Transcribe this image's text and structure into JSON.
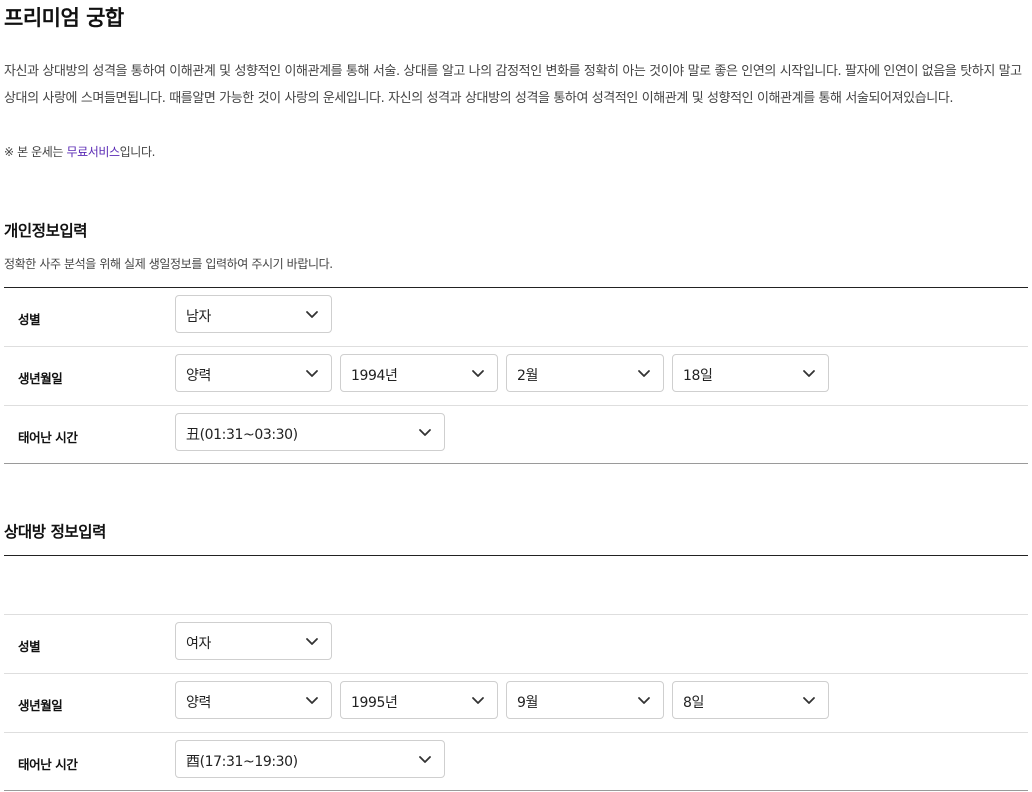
{
  "title": "프리미엄 궁합",
  "description": "자신과 상대방의 성격을 통하여 이해관계 및 성향적인 이해관계를 통해 서술. 상대를 알고 나의 감정적인 변화를 정확히 아는 것이야 말로 좋은 인연의 시작입니다. 팔자에 인연이 없음을 탓하지 말고 상대의 사랑에 스며들면됩니다. 때를알면 가능한 것이 사랑의 운세입니다. 자신의 성격과 상대방의 성격을 통하여 성격적인 이해관계 및 성향적인 이해관계를 통해 서술되어져있습니다.",
  "note": {
    "prefix": "※ 본 운세는 ",
    "link": "무료서비스",
    "suffix": "입니다."
  },
  "personal": {
    "title": "개인정보입력",
    "subtitle": "정확한 사주 분석을 위해 실제 생일정보를 입력하여 주시기 바랍니다.",
    "gender_label": "성별",
    "gender": "남자",
    "birth_label": "생년월일",
    "calendar": "양력",
    "year": "1994년",
    "month": "2월",
    "day": "18일",
    "time_label": "태어난 시간",
    "time": "丑(01:31~03:30)"
  },
  "partner": {
    "title": "상대방 정보입력",
    "gender_label": "성별",
    "gender": "여자",
    "birth_label": "생년월일",
    "calendar": "양력",
    "year": "1995년",
    "month": "9월",
    "day": "8일",
    "time_label": "태어난 시간",
    "time": "酉(17:31~19:30)"
  },
  "icons": {
    "dropdown": "chevron-down-icon"
  },
  "colors": {
    "link": "#5b2bb5",
    "rule": "#222222"
  }
}
